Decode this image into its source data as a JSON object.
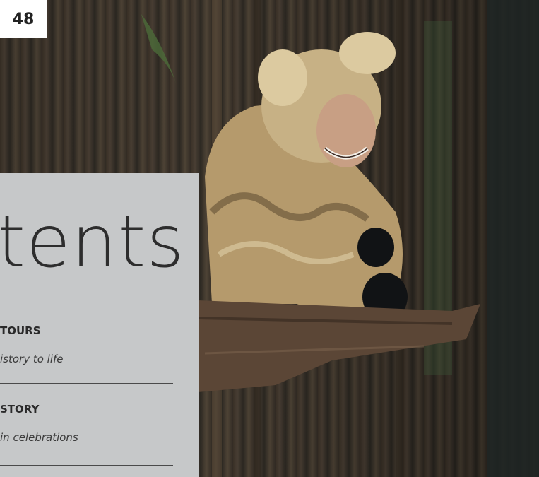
{
  "page": {
    "number": "48",
    "title": "tents"
  },
  "entries": [
    {
      "heading": "TOURS",
      "subtitle": "istory to life"
    },
    {
      "heading": "STORY",
      "subtitle": "in celebrations"
    }
  ],
  "colors": {
    "panel": "#c6c8c9",
    "page_number_bg": "#ffffff",
    "text": "#2a2a2a"
  },
  "photo": {
    "description_icon": "costumed-figure-photo"
  }
}
